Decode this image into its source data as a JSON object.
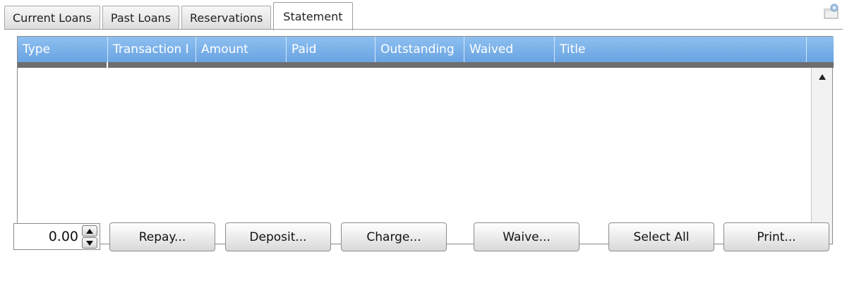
{
  "tabs": [
    {
      "label": "Current Loans",
      "active": false
    },
    {
      "label": "Past Loans",
      "active": false
    },
    {
      "label": "Reservations",
      "active": false
    },
    {
      "label": "Statement",
      "active": true
    }
  ],
  "grid": {
    "columns": [
      "Type",
      "Transaction I",
      "Amount",
      "Paid",
      "Outstanding",
      "Waived",
      "Title"
    ],
    "rows": []
  },
  "amount_spinner": {
    "value": "0.00"
  },
  "buttons": {
    "repay": "Repay...",
    "deposit": "Deposit...",
    "charge": "Charge...",
    "waive": "Waive...",
    "select_all": "Select All",
    "print": "Print..."
  },
  "colors": {
    "header_blue": "#7ab1e9",
    "strip_gray": "#6e6e6e"
  },
  "icons": {
    "corner": "panel-detach-icon",
    "scroll_up": "scroll-up-arrow-icon",
    "scroll_down": "scroll-down-arrow-icon",
    "spin_up": "spin-up-icon",
    "spin_down": "spin-down-icon"
  }
}
